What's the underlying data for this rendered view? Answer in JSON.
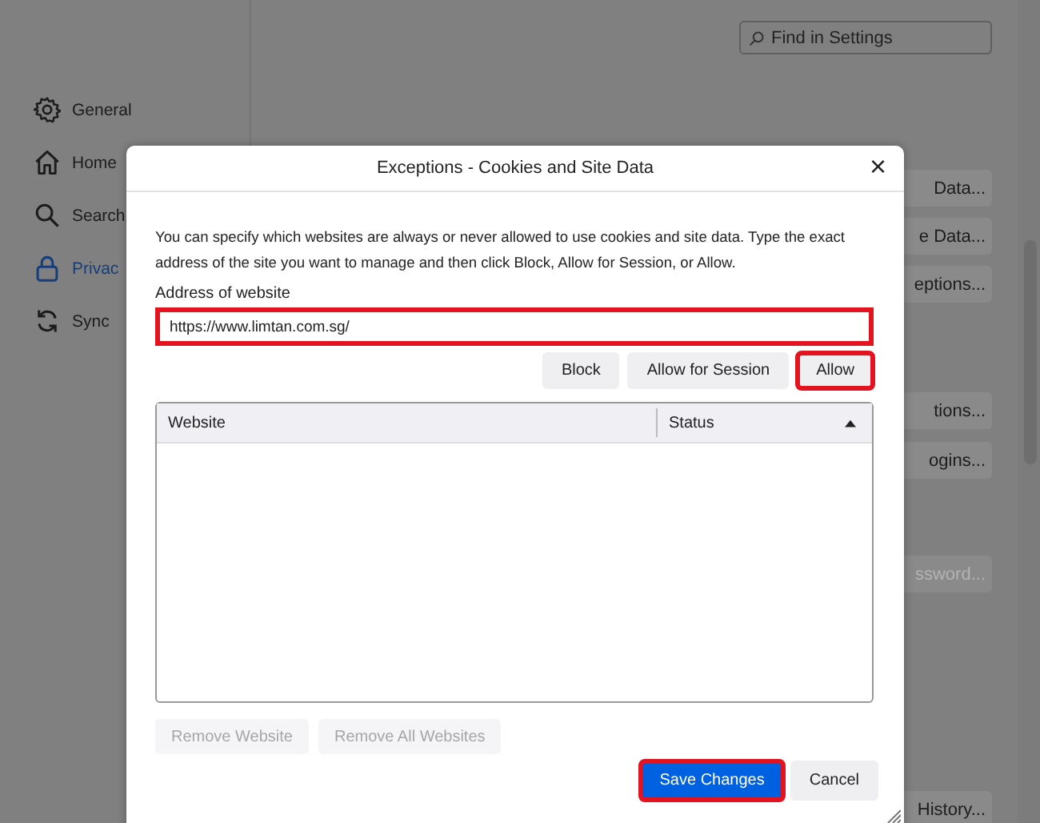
{
  "settings_page": {
    "search": {
      "placeholder": "Find in Settings"
    },
    "sidebar": {
      "items": [
        {
          "label": "General",
          "selected": false
        },
        {
          "label": "Home",
          "selected": false
        },
        {
          "label": "Search",
          "selected": false
        },
        {
          "label": "Privac",
          "selected": true
        },
        {
          "label": "Sync",
          "selected": false
        }
      ]
    },
    "buttons": [
      {
        "label": "Data...",
        "disabled": false
      },
      {
        "label": "e Data...",
        "disabled": false
      },
      {
        "label": "eptions...",
        "disabled": false
      },
      {
        "label": "tions...",
        "disabled": false
      },
      {
        "label": "ogins...",
        "disabled": false
      },
      {
        "label": "ssword...",
        "disabled": true
      },
      {
        "label": "History...",
        "disabled": false
      }
    ]
  },
  "dialog": {
    "title": "Exceptions - Cookies and Site Data",
    "close": "×",
    "description": "You can specify which websites are always or never allowed to use cookies and site data. Type the exact address of the site you want to manage and then click Block, Allow for Session, or Allow.",
    "address": {
      "label": "Address of website",
      "value": "https://www.limtan.com.sg/",
      "highlighted": true
    },
    "action_buttons": [
      {
        "label": "Block",
        "highlighted": false
      },
      {
        "label": "Allow for Session",
        "highlighted": false
      },
      {
        "label": "Allow",
        "highlighted": true
      }
    ],
    "table": {
      "columns": [
        {
          "label": "Website",
          "sorted": false
        },
        {
          "label": "Status",
          "sorted": true
        }
      ]
    },
    "remove_buttons": [
      {
        "label": "Remove Website",
        "disabled": true
      },
      {
        "label": "Remove All Websites",
        "disabled": true
      }
    ],
    "footer_buttons": [
      {
        "label": "Save Changes",
        "primary": true,
        "highlighted": true
      },
      {
        "label": "Cancel",
        "primary": false,
        "highlighted": false
      }
    ]
  }
}
